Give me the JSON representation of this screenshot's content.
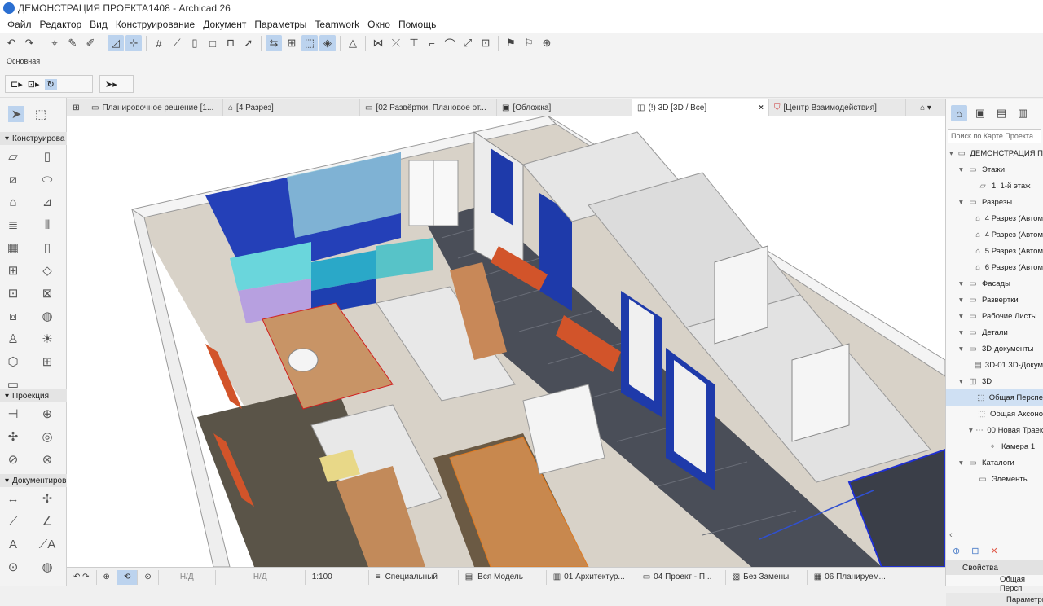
{
  "window": {
    "title": "ДЕМОНСТРАЦИЯ ПРОЕКТА1408 - Archicad 26"
  },
  "menu": [
    "Файл",
    "Редактор",
    "Вид",
    "Конструирование",
    "Документ",
    "Параметры",
    "Teamwork",
    "Окно",
    "Помощь"
  ],
  "infobox": {
    "label": "Основная"
  },
  "toolbox": {
    "sections": [
      {
        "label": "Конструирова"
      },
      {
        "label": "Проекция"
      },
      {
        "label": "Документиров"
      }
    ]
  },
  "tabs": [
    {
      "label": "Планировочное решение [1..."
    },
    {
      "label": "[4 Разрез]"
    },
    {
      "label": "[02 Развёртки. Плановое от..."
    },
    {
      "label": "[Обложка]"
    },
    {
      "label": "(!) 3D [3D / Все]"
    },
    {
      "label": "[Центр Взаимодействия]"
    }
  ],
  "statusbar": {
    "nd1": "Н/Д",
    "nd2": "Н/Д",
    "scale": "1:100",
    "special": "Специальный",
    "model": "Вся Модель",
    "layer": "01 Архитектур...",
    "project": "04 Проект - П...",
    "changes": "Без Замены",
    "plans": "06 Планируем..."
  },
  "navigator": {
    "search_placeholder": "Поиск по Карте Проекта",
    "tree": [
      {
        "label": "ДЕМОНСТРАЦИЯ П",
        "level": 0,
        "icon": "folder-icon"
      },
      {
        "label": "Этажи",
        "level": 1,
        "icon": "folder-icon"
      },
      {
        "label": "1. 1-й этаж",
        "level": 2,
        "icon": "floor-icon"
      },
      {
        "label": "Разрезы",
        "level": 1,
        "icon": "folder-icon"
      },
      {
        "label": "4 Разрез (Автом",
        "level": 2,
        "icon": "section-icon"
      },
      {
        "label": "4 Разрез (Автом",
        "level": 2,
        "icon": "section-icon"
      },
      {
        "label": "5 Разрез (Автом",
        "level": 2,
        "icon": "section-icon"
      },
      {
        "label": "6 Разрез (Автом",
        "level": 2,
        "icon": "section-icon"
      },
      {
        "label": "Фасады",
        "level": 1,
        "icon": "folder-icon"
      },
      {
        "label": "Развертки",
        "level": 1,
        "icon": "folder-icon"
      },
      {
        "label": "Рабочие Листы",
        "level": 1,
        "icon": "folder-icon"
      },
      {
        "label": "Детали",
        "level": 1,
        "icon": "folder-icon"
      },
      {
        "label": "3D-документы",
        "level": 1,
        "icon": "folder-icon"
      },
      {
        "label": "3D-01 3D-Докум",
        "level": 2,
        "icon": "doc-icon"
      },
      {
        "label": "3D",
        "level": 1,
        "icon": "cube-icon"
      },
      {
        "label": "Общая Перспе",
        "level": 2,
        "icon": "view-icon",
        "selected": true
      },
      {
        "label": "Общая Аксоно",
        "level": 2,
        "icon": "view-icon"
      },
      {
        "label": "00 Новая Траек",
        "level": 2,
        "icon": "path-icon"
      },
      {
        "label": "Камера 1",
        "level": 3,
        "icon": "camera-icon"
      },
      {
        "label": "Каталоги",
        "level": 1,
        "icon": "folder-icon"
      },
      {
        "label": "Элементы",
        "level": 2,
        "icon": "folder-icon"
      }
    ],
    "properties_label": "Свойства",
    "properties_value": "Общая Персп",
    "params_label": "Параметры"
  }
}
